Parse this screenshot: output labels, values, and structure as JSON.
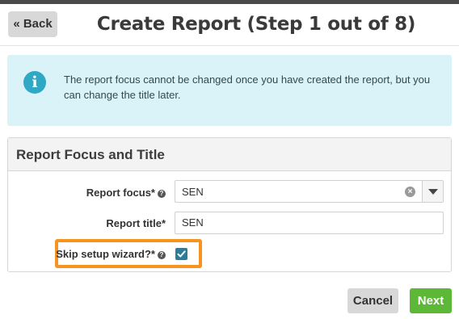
{
  "header": {
    "back_label": "« Back",
    "title": "Create Report (Step 1 out of 8)"
  },
  "info": {
    "icon": "info-icon",
    "message": "The report focus cannot be changed once you have created the report, but you can change the title later."
  },
  "panel": {
    "title": "Report Focus and Title",
    "fields": {
      "focus_label": "Report focus*",
      "focus_value": "SEN",
      "title_label": "Report title*",
      "title_value": "SEN",
      "skip_label": "Skip setup wizard?*",
      "skip_checked": true
    }
  },
  "footer": {
    "cancel_label": "Cancel",
    "next_label": "Next"
  },
  "colors": {
    "info_bg": "#d9f3f8",
    "highlight": "#f7941d",
    "next_button": "#5cb836"
  }
}
